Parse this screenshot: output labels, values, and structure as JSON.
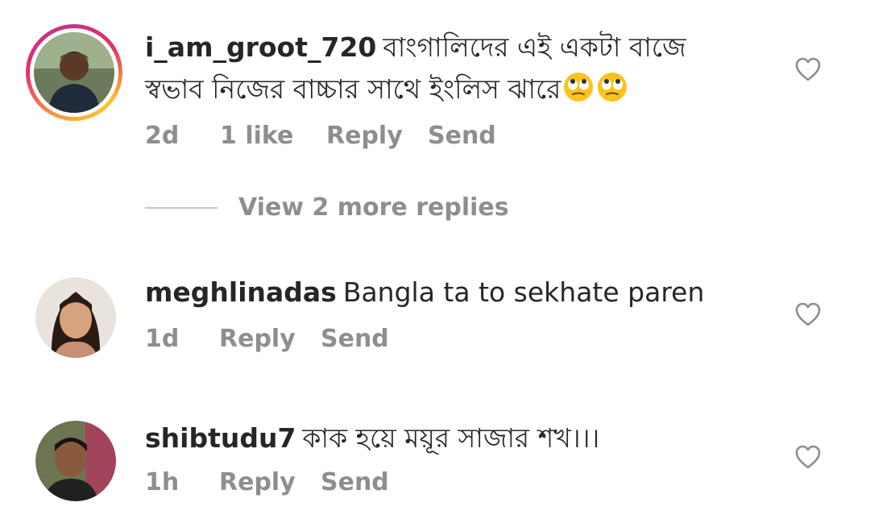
{
  "comments": [
    {
      "username": "i_am_groot_720",
      "text_line1": "বাংগালিদের এই একটা বাজে",
      "text_line2": "স্বভাব নিজের বাচ্চার সাথে ইংলিস ঝারে",
      "emoji": [
        "face-with-rolling-eyes",
        "face-with-rolling-eyes"
      ],
      "time": "2d",
      "likes": "1 like",
      "reply_label": "Reply",
      "send_label": "Send",
      "has_story_ring": true,
      "view_more": "View 2 more replies"
    },
    {
      "username": "meghlinadas",
      "text": "Bangla ta to sekhate paren",
      "time": "1d",
      "reply_label": "Reply",
      "send_label": "Send"
    },
    {
      "username": "shibtudu7",
      "text": "কাক হয়ে ময়ূর সাজার শখ।।।",
      "time": "1h",
      "reply_label": "Reply",
      "send_label": "Send"
    }
  ],
  "icons": {
    "like": "heart-outline-icon"
  },
  "colors": {
    "text": "#262626",
    "meta": "#8e8e8e",
    "story_ring_start": "#f9a03f",
    "story_ring_end": "#c13584"
  }
}
